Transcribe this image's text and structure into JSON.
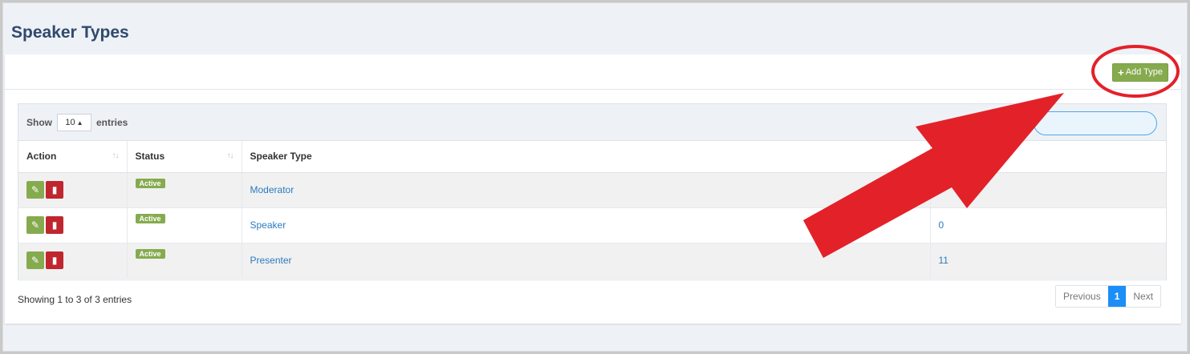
{
  "page": {
    "title": "Speaker Types"
  },
  "toolbar": {
    "add_label": "Add Type",
    "add_icon": "plus-icon"
  },
  "table_controls": {
    "show_label": "Show",
    "entries_label": "entries",
    "page_length": "10",
    "search_value": ""
  },
  "table": {
    "columns": [
      "Action",
      "Status",
      "Speaker Type",
      ""
    ],
    "rows": [
      {
        "status": "Active",
        "speaker_type": "Moderator",
        "count": ""
      },
      {
        "status": "Active",
        "speaker_type": "Speaker",
        "count": "0"
      },
      {
        "status": "Active",
        "speaker_type": "Presenter",
        "count": "11"
      }
    ]
  },
  "footer": {
    "info": "Showing 1 to 3 of 3 entries",
    "previous": "Previous",
    "current_page": "1",
    "next": "Next"
  },
  "colors": {
    "accent_green": "#86ab4f",
    "delete_red": "#c0262d",
    "link_blue": "#2b7bc0",
    "annotation_red": "#e32129"
  },
  "icons": {
    "edit": "edit-icon",
    "delete": "trash-icon",
    "sort": "sort-icon",
    "select_arrows": "select-arrows-icon"
  }
}
